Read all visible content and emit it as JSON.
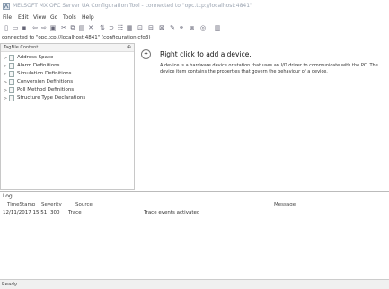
{
  "window": {
    "title": "MELSOFT MX OPC Server UA Configuration Tool - connected to \"opc.tcp://localhost:4841\""
  },
  "menu": [
    "File",
    "Edit",
    "View",
    "Go",
    "Tools",
    "Help"
  ],
  "toolbar_icons": [
    "new-icon",
    "open-icon",
    "save-icon",
    "back-icon",
    "forward-icon",
    "refresh-icon",
    "cut-icon",
    "copy-icon",
    "paste-icon",
    "delete-icon",
    "sort-icon",
    "filter-icon",
    "table-icon",
    "grid-icon",
    "new-item-icon",
    "properties-icon",
    "script-icon",
    "edit-icon",
    "link-icon",
    "device-icon",
    "watch-icon",
    "help-icon"
  ],
  "connection": {
    "text": "connected to \"opc.tcp://localhost:4841\" (configuration.cfg3)"
  },
  "tree": {
    "header": "TagFile Content",
    "items": [
      {
        "label": "Address Space"
      },
      {
        "label": "Alarm Definitions"
      },
      {
        "label": "Simulation Definitions"
      },
      {
        "label": "Conversion Definitions"
      },
      {
        "label": "Poll Method Definitions"
      },
      {
        "label": "Structure Type Declarations"
      }
    ]
  },
  "info": {
    "heading": "Right click to add a device.",
    "description": "A device is a hardware device or station that uses an I/O driver to communicate with the PC. The device item contains the properties that govern the behaviour of a device."
  },
  "log": {
    "title": "Log",
    "columns": {
      "timestamp": "TimeStamp",
      "severity": "Severity",
      "source": "Source",
      "message": "Message"
    },
    "rows": [
      {
        "timestamp": "12/11/2017 15:51",
        "severity": "300",
        "source": "Trace",
        "message": "Trace events activated"
      }
    ]
  },
  "status": {
    "text": "Ready"
  }
}
